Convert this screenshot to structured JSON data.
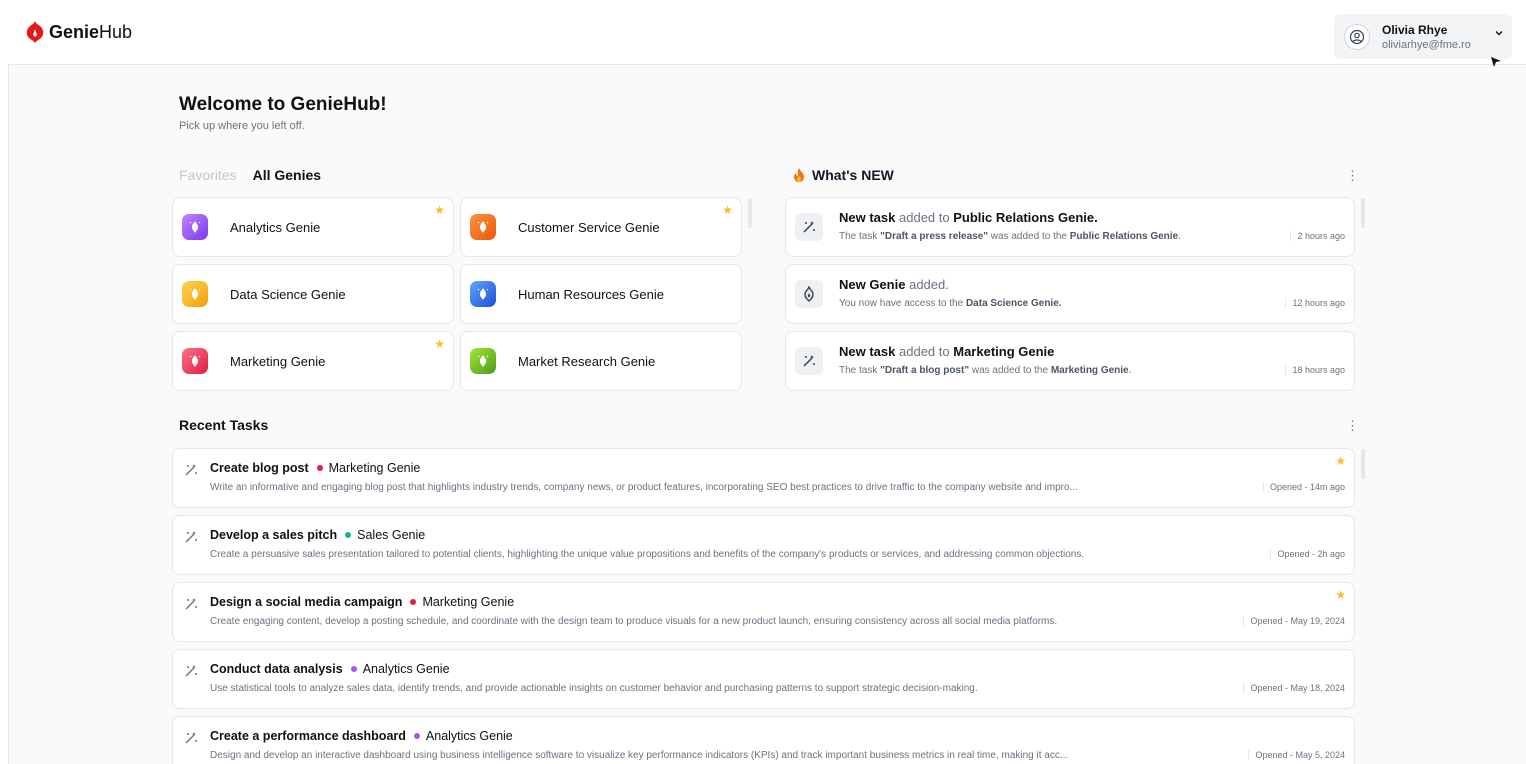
{
  "header": {
    "logo_bold": "Genie",
    "logo_rest": "Hub",
    "user": {
      "name": "Olivia Rhye",
      "email": "oliviarhye@fme.ro"
    }
  },
  "welcome": {
    "title": "Welcome to GenieHub!",
    "subtitle": "Pick up where you left off."
  },
  "tabs": {
    "favorites": "Favorites",
    "all": "All Genies"
  },
  "genies": [
    {
      "name": "Analytics Genie",
      "color": "#a855f7",
      "starred": true
    },
    {
      "name": "Customer Service Genie",
      "color": "#f97316",
      "starred": true
    },
    {
      "name": "Data Science Genie",
      "color": "#f5b82e",
      "starred": false
    },
    {
      "name": "Human Resources Genie",
      "color": "#3b6fe0",
      "starred": false
    },
    {
      "name": "Marketing Genie",
      "color": "#e11d48",
      "starred": true
    },
    {
      "name": "Market Research Genie",
      "color": "#65b82a",
      "starred": false
    }
  ],
  "news": {
    "title": "What's NEW",
    "items": [
      {
        "title_bold1": "New task",
        "title_mid": "added to",
        "title_bold2": "Public Relations Genie.",
        "desc_pre": "The task ",
        "desc_b1": "\"Draft a press release\"",
        "desc_mid": " was added to the ",
        "desc_b2": "Public Relations Genie",
        "desc_end": ".",
        "time": "2 hours ago",
        "icon": "wand-icon"
      },
      {
        "title_bold1": "New Genie",
        "title_mid": "added.",
        "title_bold2": "",
        "desc_pre": "You now have access to the ",
        "desc_b1": "Data Science Genie.",
        "desc_mid": "",
        "desc_b2": "",
        "desc_end": "",
        "time": "12 hours ago",
        "icon": "genie-outline-icon"
      },
      {
        "title_bold1": "New task",
        "title_mid": "added to",
        "title_bold2": "Marketing Genie",
        "desc_pre": "The task ",
        "desc_b1": "\"Draft a blog post\"",
        "desc_mid": " was added to the ",
        "desc_b2": "Marketing Genie",
        "desc_end": ".",
        "time": "18 hours ago",
        "icon": "wand-icon"
      }
    ]
  },
  "recent": {
    "title": "Recent Tasks",
    "tasks": [
      {
        "title": "Create blog post",
        "genie": "Marketing Genie",
        "dot": "#e11d48",
        "desc": "Write an informative and engaging blog post that highlights industry trends, company news, or product features, incorporating SEO best practices to drive traffic to the company website and impro...",
        "time": "Opened - 14m ago",
        "starred": true
      },
      {
        "title": "Develop a sales pitch",
        "genie": "Sales Genie",
        "dot": "#10b981",
        "desc": "Create a persuasive sales presentation tailored to potential clients, highlighting the unique value propositions and benefits of the company's products or services, and addressing common objections.",
        "time": "Opened - 2h ago",
        "starred": false
      },
      {
        "title": "Design a social media campaign",
        "genie": "Marketing Genie",
        "dot": "#e11d48",
        "desc": "Create engaging content, develop a posting schedule, and coordinate with the design team to produce visuals for a new product launch, ensuring consistency across all social media platforms.",
        "time": "Opened - May 19, 2024",
        "starred": true
      },
      {
        "title": "Conduct data analysis",
        "genie": "Analytics Genie",
        "dot": "#a855f7",
        "desc": "Use statistical tools to analyze sales data, identify trends, and provide actionable insights on customer behavior and purchasing patterns to support strategic decision-making.",
        "time": "Opened - May 18, 2024",
        "starred": false
      },
      {
        "title": "Create a performance dashboard",
        "genie": "Analytics Genie",
        "dot": "#a855f7",
        "desc": "Design and develop an interactive dashboard using business intelligence software to visualize key performance indicators (KPIs) and track important business metrics in real time, making it acc...",
        "time": "Opened - May 5, 2024",
        "starred": false
      }
    ]
  }
}
